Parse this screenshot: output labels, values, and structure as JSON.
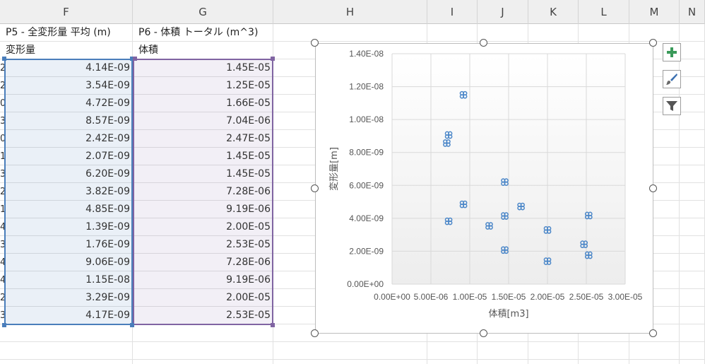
{
  "columns": [
    {
      "label": "F",
      "w": 188
    },
    {
      "label": "G",
      "w": 199
    },
    {
      "label": "H",
      "w": 218
    },
    {
      "label": "I",
      "w": 71
    },
    {
      "label": "J",
      "w": 72
    },
    {
      "label": "K",
      "w": 71
    },
    {
      "label": "L",
      "w": 72
    },
    {
      "label": "M",
      "w": 71
    },
    {
      "label": "N",
      "w": 36
    }
  ],
  "headers": {
    "F1": "P5 - 全変形量 平均 (m)",
    "G1": "P6 - 体積 トータル (m^3)",
    "F2": "変形量",
    "G2": "体積"
  },
  "row_stubs": [
    "2",
    "2",
    "0",
    "3",
    "0",
    "1",
    "3",
    "2",
    "1",
    "4",
    "3",
    "4",
    "4",
    "2",
    "3"
  ],
  "table": {
    "deformation": [
      "4.14E-09",
      "3.54E-09",
      "4.72E-09",
      "8.57E-09",
      "2.42E-09",
      "2.07E-09",
      "6.20E-09",
      "3.82E-09",
      "4.85E-09",
      "1.39E-09",
      "1.76E-09",
      "9.06E-09",
      "1.15E-08",
      "3.29E-09",
      "4.17E-09"
    ],
    "volume": [
      "1.45E-05",
      "1.25E-05",
      "1.66E-05",
      "7.04E-06",
      "2.47E-05",
      "1.45E-05",
      "1.45E-05",
      "7.28E-06",
      "9.19E-06",
      "2.00E-05",
      "2.53E-05",
      "7.28E-06",
      "9.19E-06",
      "2.00E-05",
      "2.53E-05"
    ]
  },
  "chart_data": {
    "type": "scatter",
    "title": "",
    "xlabel": "体積[m3]",
    "ylabel": "変形量[m]",
    "xlim": [
      0,
      3e-05
    ],
    "ylim": [
      0,
      1.4e-08
    ],
    "xticks": [
      "0.00E+00",
      "5.00E-06",
      "1.00E-05",
      "1.50E-05",
      "2.00E-05",
      "2.50E-05",
      "3.00E-05"
    ],
    "yticks": [
      "0.00E+00",
      "2.00E-09",
      "4.00E-09",
      "6.00E-09",
      "8.00E-09",
      "1.00E-08",
      "1.20E-08",
      "1.40E-08"
    ],
    "grid": true,
    "marker_color": "#4a86c8",
    "points": [
      {
        "x": 1.45e-05,
        "y": 4.14e-09
      },
      {
        "x": 1.25e-05,
        "y": 3.54e-09
      },
      {
        "x": 1.66e-05,
        "y": 4.72e-09
      },
      {
        "x": 7.04e-06,
        "y": 8.57e-09
      },
      {
        "x": 2.47e-05,
        "y": 2.42e-09
      },
      {
        "x": 1.45e-05,
        "y": 2.07e-09
      },
      {
        "x": 1.45e-05,
        "y": 6.2e-09
      },
      {
        "x": 7.28e-06,
        "y": 3.82e-09
      },
      {
        "x": 9.19e-06,
        "y": 4.85e-09
      },
      {
        "x": 2e-05,
        "y": 1.39e-09
      },
      {
        "x": 2.53e-05,
        "y": 1.76e-09
      },
      {
        "x": 7.28e-06,
        "y": 9.06e-09
      },
      {
        "x": 9.19e-06,
        "y": 1.15e-08
      },
      {
        "x": 2e-05,
        "y": 3.29e-09
      },
      {
        "x": 2.53e-05,
        "y": 4.17e-09
      }
    ]
  },
  "chart_buttons": [
    {
      "icon": "plus-icon",
      "color": "#3a9a5a"
    },
    {
      "icon": "brush-icon",
      "color": "#3a6fb0"
    },
    {
      "icon": "funnel-icon",
      "color": "#555555"
    }
  ]
}
